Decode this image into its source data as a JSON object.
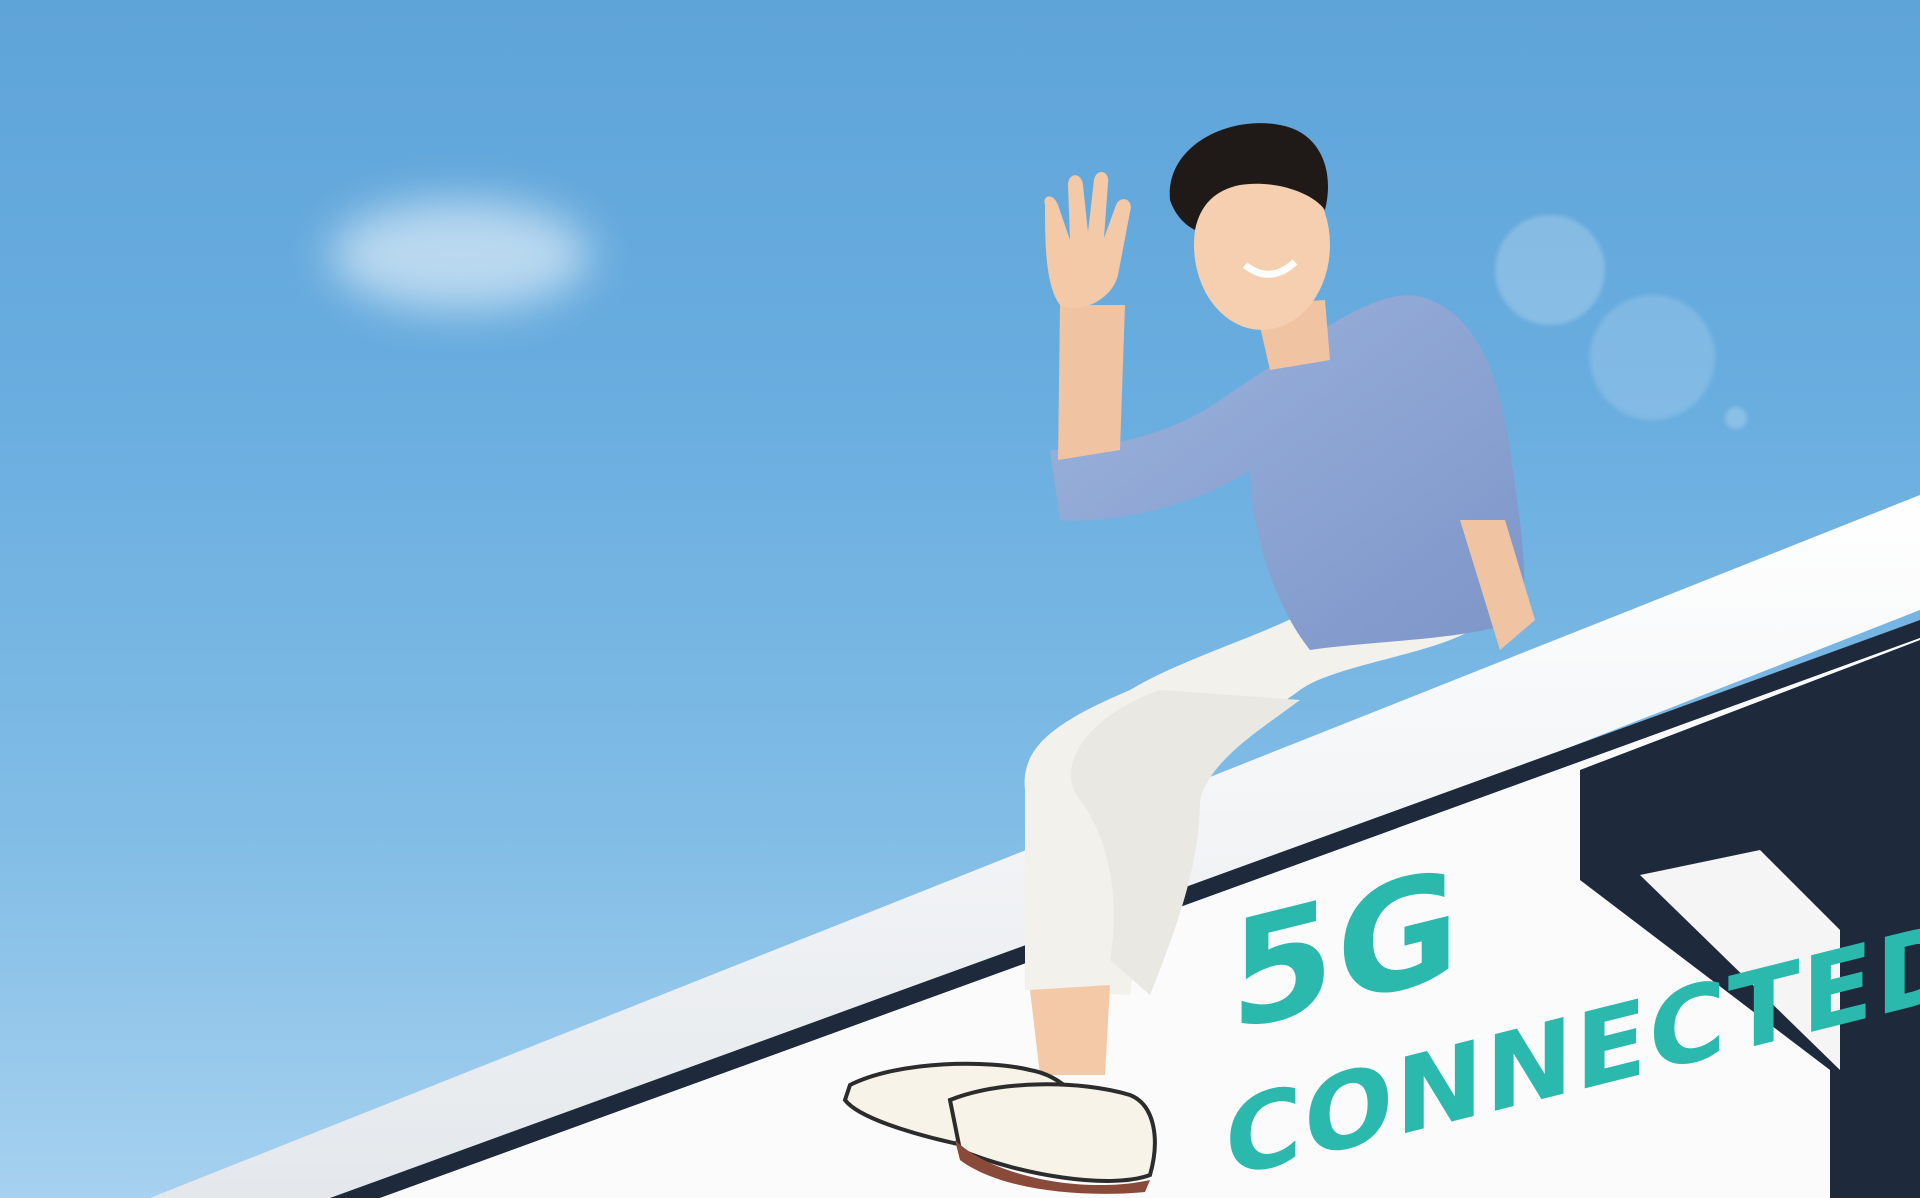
{
  "ad": {
    "headline_line1": "5G",
    "headline_line2": "CONNECTED"
  },
  "colors": {
    "sky_top": "#5fa4d9",
    "sky_bottom": "#a6d1ef",
    "accent_teal": "#2bb8ad",
    "shirt_blue": "#8fa8d6",
    "pants_white": "#f2f1ec",
    "bus_white": "#fbfbfb",
    "bus_dark": "#1e2a3b"
  }
}
